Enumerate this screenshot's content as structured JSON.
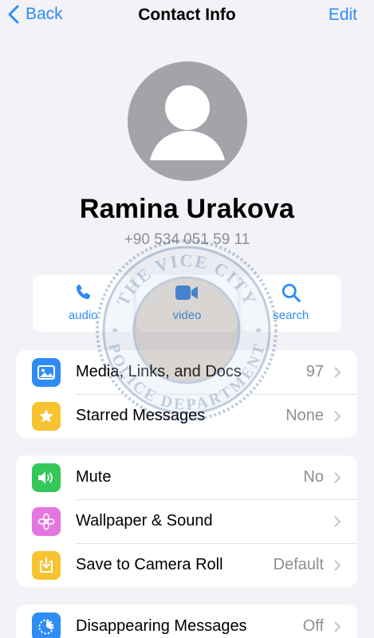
{
  "nav": {
    "back_label": "Back",
    "title": "Contact Info",
    "edit_label": "Edit"
  },
  "contact": {
    "name": "Ramina Urakova",
    "phone": "+90 534 051 59 11"
  },
  "actions": [
    {
      "label": "audio",
      "icon": "phone-icon"
    },
    {
      "label": "video",
      "icon": "video-camera-icon"
    },
    {
      "label": "search",
      "icon": "search-icon"
    }
  ],
  "group1": [
    {
      "label": "Media, Links, and Docs",
      "value": "97",
      "icon": "photo-icon",
      "color": "#2f8cf5"
    },
    {
      "label": "Starred Messages",
      "value": "None",
      "icon": "star-icon",
      "color": "#f7c331"
    }
  ],
  "group2": [
    {
      "label": "Mute",
      "value": "No",
      "icon": "speaker-icon",
      "color": "#34c759"
    },
    {
      "label": "Wallpaper & Sound",
      "value": "",
      "icon": "flower-icon",
      "color": "#e476e0"
    },
    {
      "label": "Save to Camera Roll",
      "value": "Default",
      "icon": "download-icon",
      "color": "#f7c331"
    }
  ],
  "group3": [
    {
      "label": "Disappearing Messages",
      "value": "Off",
      "icon": "timer-icon",
      "color": "#2f8cf5"
    }
  ],
  "watermark": {
    "top_text": "THE VICE CITY",
    "bottom_text": "POLICE DEPARTMENT"
  },
  "colors": {
    "accent": "#2f8cf5",
    "background": "#f2f2f7",
    "secondary_text": "#8e8e93"
  }
}
